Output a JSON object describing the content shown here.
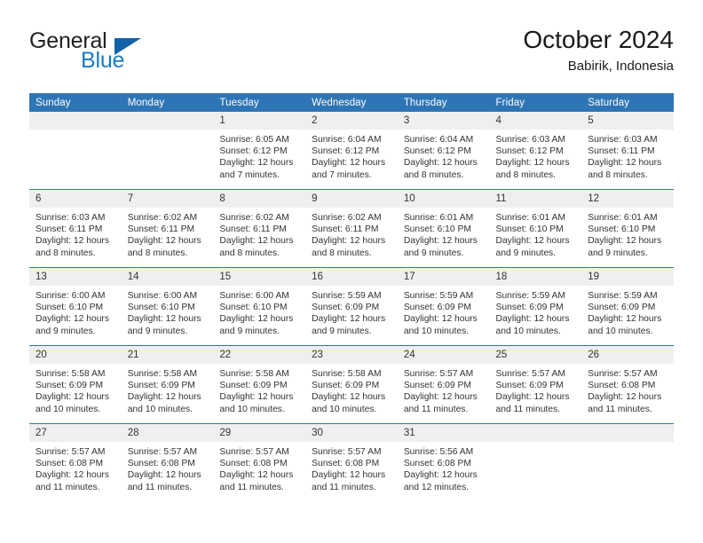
{
  "brand": {
    "name_part1": "General",
    "name_part2": "Blue"
  },
  "header": {
    "title": "October 2024",
    "location": "Babirik, Indonesia"
  },
  "colors": {
    "header_blue": "#2E75B6",
    "daynum_band": "#EFEFEF",
    "brand_blue": "#1B7AC7",
    "logo_triangle": "#1362A8",
    "text": "#333333"
  },
  "weekdays": [
    "Sunday",
    "Monday",
    "Tuesday",
    "Wednesday",
    "Thursday",
    "Friday",
    "Saturday"
  ],
  "labels": {
    "sunrise": "Sunrise:",
    "sunset": "Sunset:",
    "daylight": "Daylight:"
  },
  "weeks": [
    [
      {
        "day": "",
        "empty": true
      },
      {
        "day": "",
        "empty": true
      },
      {
        "day": "1",
        "sunrise": "Sunrise: 6:05 AM",
        "sunset": "Sunset: 6:12 PM",
        "daylight1": "Daylight: 12 hours",
        "daylight2": "and 7 minutes."
      },
      {
        "day": "2",
        "sunrise": "Sunrise: 6:04 AM",
        "sunset": "Sunset: 6:12 PM",
        "daylight1": "Daylight: 12 hours",
        "daylight2": "and 7 minutes."
      },
      {
        "day": "3",
        "sunrise": "Sunrise: 6:04 AM",
        "sunset": "Sunset: 6:12 PM",
        "daylight1": "Daylight: 12 hours",
        "daylight2": "and 8 minutes."
      },
      {
        "day": "4",
        "sunrise": "Sunrise: 6:03 AM",
        "sunset": "Sunset: 6:12 PM",
        "daylight1": "Daylight: 12 hours",
        "daylight2": "and 8 minutes."
      },
      {
        "day": "5",
        "sunrise": "Sunrise: 6:03 AM",
        "sunset": "Sunset: 6:11 PM",
        "daylight1": "Daylight: 12 hours",
        "daylight2": "and 8 minutes."
      }
    ],
    [
      {
        "day": "6",
        "sunrise": "Sunrise: 6:03 AM",
        "sunset": "Sunset: 6:11 PM",
        "daylight1": "Daylight: 12 hours",
        "daylight2": "and 8 minutes."
      },
      {
        "day": "7",
        "sunrise": "Sunrise: 6:02 AM",
        "sunset": "Sunset: 6:11 PM",
        "daylight1": "Daylight: 12 hours",
        "daylight2": "and 8 minutes."
      },
      {
        "day": "8",
        "sunrise": "Sunrise: 6:02 AM",
        "sunset": "Sunset: 6:11 PM",
        "daylight1": "Daylight: 12 hours",
        "daylight2": "and 8 minutes."
      },
      {
        "day": "9",
        "sunrise": "Sunrise: 6:02 AM",
        "sunset": "Sunset: 6:11 PM",
        "daylight1": "Daylight: 12 hours",
        "daylight2": "and 8 minutes."
      },
      {
        "day": "10",
        "sunrise": "Sunrise: 6:01 AM",
        "sunset": "Sunset: 6:10 PM",
        "daylight1": "Daylight: 12 hours",
        "daylight2": "and 9 minutes."
      },
      {
        "day": "11",
        "sunrise": "Sunrise: 6:01 AM",
        "sunset": "Sunset: 6:10 PM",
        "daylight1": "Daylight: 12 hours",
        "daylight2": "and 9 minutes."
      },
      {
        "day": "12",
        "sunrise": "Sunrise: 6:01 AM",
        "sunset": "Sunset: 6:10 PM",
        "daylight1": "Daylight: 12 hours",
        "daylight2": "and 9 minutes."
      }
    ],
    [
      {
        "day": "13",
        "sunrise": "Sunrise: 6:00 AM",
        "sunset": "Sunset: 6:10 PM",
        "daylight1": "Daylight: 12 hours",
        "daylight2": "and 9 minutes."
      },
      {
        "day": "14",
        "sunrise": "Sunrise: 6:00 AM",
        "sunset": "Sunset: 6:10 PM",
        "daylight1": "Daylight: 12 hours",
        "daylight2": "and 9 minutes."
      },
      {
        "day": "15",
        "sunrise": "Sunrise: 6:00 AM",
        "sunset": "Sunset: 6:10 PM",
        "daylight1": "Daylight: 12 hours",
        "daylight2": "and 9 minutes."
      },
      {
        "day": "16",
        "sunrise": "Sunrise: 5:59 AM",
        "sunset": "Sunset: 6:09 PM",
        "daylight1": "Daylight: 12 hours",
        "daylight2": "and 9 minutes."
      },
      {
        "day": "17",
        "sunrise": "Sunrise: 5:59 AM",
        "sunset": "Sunset: 6:09 PM",
        "daylight1": "Daylight: 12 hours",
        "daylight2": "and 10 minutes."
      },
      {
        "day": "18",
        "sunrise": "Sunrise: 5:59 AM",
        "sunset": "Sunset: 6:09 PM",
        "daylight1": "Daylight: 12 hours",
        "daylight2": "and 10 minutes."
      },
      {
        "day": "19",
        "sunrise": "Sunrise: 5:59 AM",
        "sunset": "Sunset: 6:09 PM",
        "daylight1": "Daylight: 12 hours",
        "daylight2": "and 10 minutes."
      }
    ],
    [
      {
        "day": "20",
        "sunrise": "Sunrise: 5:58 AM",
        "sunset": "Sunset: 6:09 PM",
        "daylight1": "Daylight: 12 hours",
        "daylight2": "and 10 minutes."
      },
      {
        "day": "21",
        "sunrise": "Sunrise: 5:58 AM",
        "sunset": "Sunset: 6:09 PM",
        "daylight1": "Daylight: 12 hours",
        "daylight2": "and 10 minutes."
      },
      {
        "day": "22",
        "sunrise": "Sunrise: 5:58 AM",
        "sunset": "Sunset: 6:09 PM",
        "daylight1": "Daylight: 12 hours",
        "daylight2": "and 10 minutes."
      },
      {
        "day": "23",
        "sunrise": "Sunrise: 5:58 AM",
        "sunset": "Sunset: 6:09 PM",
        "daylight1": "Daylight: 12 hours",
        "daylight2": "and 10 minutes."
      },
      {
        "day": "24",
        "sunrise": "Sunrise: 5:57 AM",
        "sunset": "Sunset: 6:09 PM",
        "daylight1": "Daylight: 12 hours",
        "daylight2": "and 11 minutes."
      },
      {
        "day": "25",
        "sunrise": "Sunrise: 5:57 AM",
        "sunset": "Sunset: 6:09 PM",
        "daylight1": "Daylight: 12 hours",
        "daylight2": "and 11 minutes."
      },
      {
        "day": "26",
        "sunrise": "Sunrise: 5:57 AM",
        "sunset": "Sunset: 6:08 PM",
        "daylight1": "Daylight: 12 hours",
        "daylight2": "and 11 minutes."
      }
    ],
    [
      {
        "day": "27",
        "sunrise": "Sunrise: 5:57 AM",
        "sunset": "Sunset: 6:08 PM",
        "daylight1": "Daylight: 12 hours",
        "daylight2": "and 11 minutes."
      },
      {
        "day": "28",
        "sunrise": "Sunrise: 5:57 AM",
        "sunset": "Sunset: 6:08 PM",
        "daylight1": "Daylight: 12 hours",
        "daylight2": "and 11 minutes."
      },
      {
        "day": "29",
        "sunrise": "Sunrise: 5:57 AM",
        "sunset": "Sunset: 6:08 PM",
        "daylight1": "Daylight: 12 hours",
        "daylight2": "and 11 minutes."
      },
      {
        "day": "30",
        "sunrise": "Sunrise: 5:57 AM",
        "sunset": "Sunset: 6:08 PM",
        "daylight1": "Daylight: 12 hours",
        "daylight2": "and 11 minutes."
      },
      {
        "day": "31",
        "sunrise": "Sunrise: 5:56 AM",
        "sunset": "Sunset: 6:08 PM",
        "daylight1": "Daylight: 12 hours",
        "daylight2": "and 12 minutes."
      },
      {
        "day": "",
        "empty": true
      },
      {
        "day": "",
        "empty": true
      }
    ]
  ]
}
